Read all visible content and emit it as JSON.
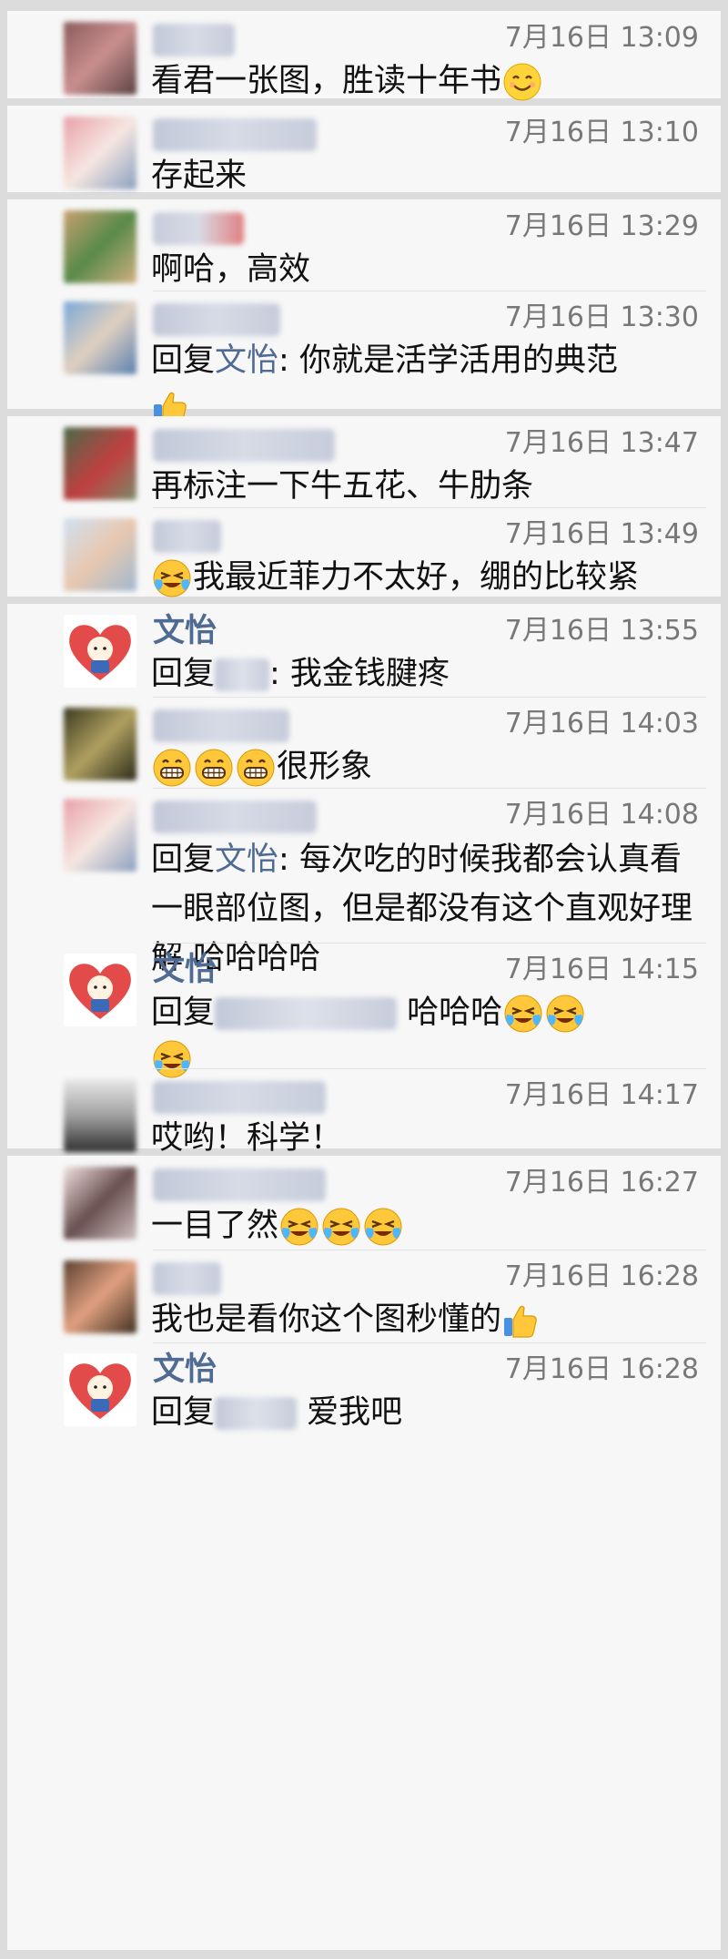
{
  "comments": [
    {
      "id": "c1",
      "time": "7月16日 13:09",
      "text": "看君一张图，胜读十年书"
    },
    {
      "id": "c2",
      "time": "7月16日 13:10",
      "text": "存起来"
    },
    {
      "id": "c3",
      "time": "7月16日 13:29",
      "text": "啊哈，高效"
    },
    {
      "id": "c4",
      "time": "7月16日 13:30",
      "reply_prefix": "回复",
      "reply_to": "文怡",
      "text": ": 你就是活学活用的典范"
    },
    {
      "id": "c5",
      "time": "7月16日 13:47",
      "text": "再标注一下牛五花、牛肋条"
    },
    {
      "id": "c6",
      "time": "7月16日 13:49",
      "text": "我最近菲力不太好，绷的比较紧"
    },
    {
      "id": "c7",
      "name": "文怡",
      "time": "7月16日 13:55",
      "reply_prefix": "回复",
      "text": ": 我金钱腱疼"
    },
    {
      "id": "c8",
      "time": "7月16日 14:03",
      "text": "很形象"
    },
    {
      "id": "c9",
      "time": "7月16日 14:08",
      "reply_prefix": "回复",
      "reply_to": "文怡",
      "text": ": 每次吃的时候我都会认真看一眼部位图，但是都没有这个直观好理解 哈哈哈哈"
    },
    {
      "id": "c10",
      "name": "文怡",
      "time": "7月16日 14:15",
      "reply_prefix": "回复",
      "text": "哈哈哈"
    },
    {
      "id": "c11",
      "time": "7月16日 14:17",
      "text": "哎哟！科学！"
    },
    {
      "id": "c12",
      "time": "7月16日 16:27",
      "text": "一目了然"
    },
    {
      "id": "c13",
      "time": "7月16日 16:28",
      "text": "我也是看你这个图秒懂的"
    },
    {
      "id": "c14",
      "name": "文怡",
      "time": "7月16日 16:28",
      "reply_prefix": "回复",
      "text": "爱我吧"
    }
  ],
  "colors": {
    "link": "#4f6a93",
    "time": "#787878",
    "card": "#f7f7f7",
    "page": "#dcdcdc"
  },
  "icons": [
    "smile-emoji-icon",
    "grin-emoji-icon",
    "laugh-cry-emoji-icon",
    "thumbs-up-icon"
  ]
}
